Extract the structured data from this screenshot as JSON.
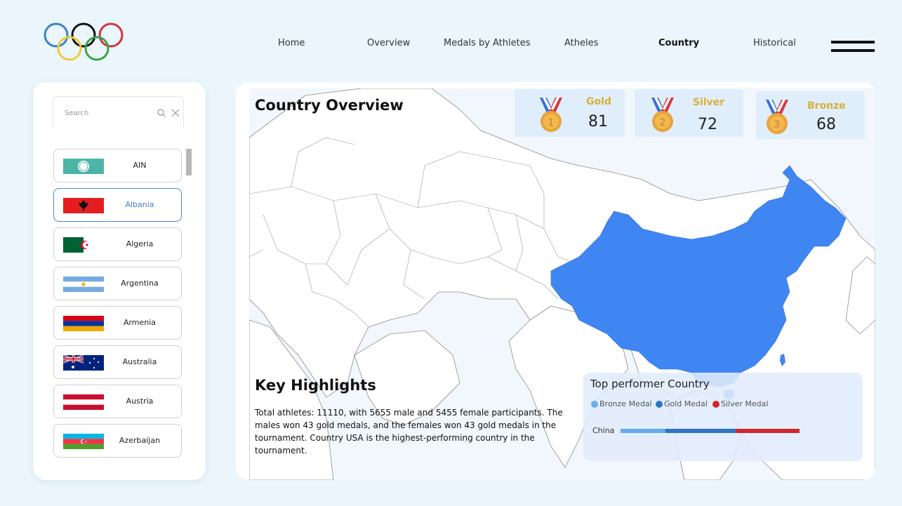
{
  "nav": {
    "items": [
      {
        "label": "Home",
        "active": false
      },
      {
        "label": "Overview",
        "active": false
      },
      {
        "label": "Medals by Athletes",
        "active": false
      },
      {
        "label": "Atheles",
        "active": false
      },
      {
        "label": "Country",
        "active": true
      },
      {
        "label": "Historical",
        "active": false
      }
    ]
  },
  "sidebar": {
    "search_placeholder": "Search",
    "countries": [
      {
        "name": "AIN",
        "flag": "ain-flag",
        "selected": false
      },
      {
        "name": "Albania",
        "flag": "albania-flag",
        "selected": true
      },
      {
        "name": "Algeria",
        "flag": "algeria-flag",
        "selected": false
      },
      {
        "name": "Argentina",
        "flag": "argentina-flag",
        "selected": false
      },
      {
        "name": "Armenia",
        "flag": "armenia-flag",
        "selected": false
      },
      {
        "name": "Australia",
        "flag": "australia-flag",
        "selected": false
      },
      {
        "name": "Austria",
        "flag": "austria-flag",
        "selected": false
      },
      {
        "name": "Azerbaijan",
        "flag": "azerbaijan-flag",
        "selected": false
      }
    ]
  },
  "main": {
    "title": "Country Overview",
    "medals": {
      "gold": {
        "label": "Gold",
        "value": "81",
        "number": "1",
        "color": "#e8a33c"
      },
      "silver": {
        "label": "Silver",
        "value": "72",
        "number": "2",
        "color": "#e8a33c"
      },
      "bronze": {
        "label": "Bronze",
        "value": "68",
        "number": "3",
        "color": "#e8a33c"
      }
    },
    "map": {
      "highlighted_country": "China",
      "highlight_color": "#3f86f2"
    },
    "highlights": {
      "title": "Key Highlights",
      "text": "Total athletes: 11110, with 5655 male and 5455 female participants. The males won 43 gold medals, and the females won 43 gold medals in the tournament. Country USA is the highest-performing country in the tournament."
    },
    "top_performer": {
      "title": "Top performer Country",
      "legend": [
        {
          "label": "Bronze Medal",
          "color": "#6aaaf0"
        },
        {
          "label": "Gold Medal",
          "color": "#2f75c6"
        },
        {
          "label": "Silver Medal",
          "color": "#d0262f"
        }
      ]
    }
  },
  "chart_data": {
    "type": "bar",
    "orientation": "horizontal",
    "stacked": true,
    "title": "Top performer Country",
    "categories": [
      "China"
    ],
    "series": [
      {
        "name": "Bronze Medal",
        "values": [
          24
        ],
        "color": "#6aaaf0"
      },
      {
        "name": "Gold Medal",
        "values": [
          37
        ],
        "color": "#2f75c6"
      },
      {
        "name": "Silver Medal",
        "values": [
          34
        ],
        "color": "#d0262f"
      }
    ],
    "legend": "top-left",
    "grid": false
  }
}
